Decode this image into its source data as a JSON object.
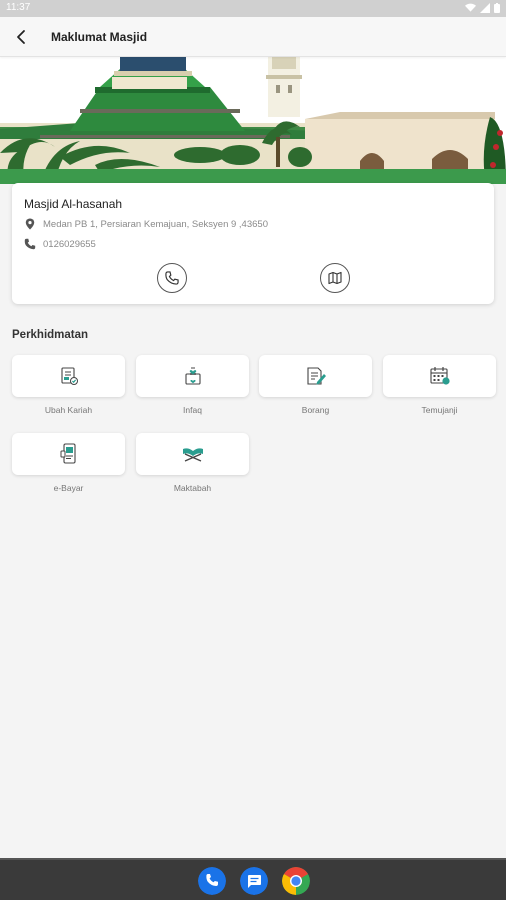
{
  "status_bar": {
    "time": "11:37",
    "icons": [
      "wifi-icon",
      "signal-icon",
      "battery-icon"
    ]
  },
  "app_bar": {
    "title": "Maklumat Masjid",
    "back_icon": "arrow-left-icon"
  },
  "mosque": {
    "name": "Masjid Al-hasanah",
    "address": "Medan PB 1, Persiaran Kemajuan, Seksyen 9 ,43650",
    "phone": "0126029655",
    "actions": [
      "phone-icon",
      "map-icon"
    ]
  },
  "services": {
    "title": "Perkhidmatan",
    "items": [
      {
        "label": "Ubah Kariah",
        "icon": "document-check-icon"
      },
      {
        "label": "Infaq",
        "icon": "donation-box-icon"
      },
      {
        "label": "Borang",
        "icon": "form-edit-icon"
      },
      {
        "label": "Temujanji",
        "icon": "calendar-icon"
      },
      {
        "label": "e-Bayar",
        "icon": "mobile-payment-icon"
      },
      {
        "label": "Maktabah",
        "icon": "quran-book-icon"
      }
    ]
  },
  "dock": [
    "phone-app-icon",
    "messages-app-icon",
    "chrome-app-icon"
  ],
  "colors": {
    "accent": "#2a9d8f",
    "app_bar": "#f7f7f7",
    "background": "#f4f4f4",
    "nav_bar": "#3a3a3a"
  }
}
